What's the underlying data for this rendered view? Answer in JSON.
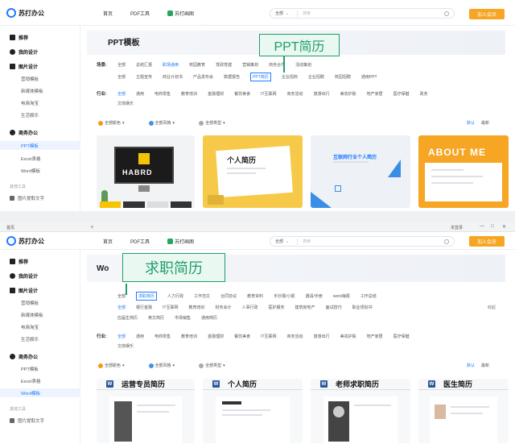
{
  "top": {
    "logo_text": "苏打办公",
    "nav": [
      "首页",
      "PDF工具",
      "苏打画图"
    ],
    "search": {
      "select": "全部",
      "placeholder": "搜索"
    },
    "join_button": "加入会员",
    "sidebar": {
      "heads": [
        "推荐",
        "我的设计",
        "图片设计",
        "商务办公"
      ],
      "image_design": [
        "营销模板",
        "新媒体模板",
        "电商淘宝",
        "生活娱乐"
      ],
      "office": [
        "PPT模板",
        "Excel表格",
        "Word模板"
      ],
      "other_label": "其他工具",
      "other_item": "图片提取文字"
    },
    "page_title": "PPT模板",
    "row1_label": "场景:",
    "row1": [
      "全部",
      "总结汇报",
      "职场通用",
      "校园教育",
      "党政党建",
      "营销策划",
      "商务合作",
      "活动策划"
    ],
    "row2": [
      "全部",
      "主题宣传",
      "商业计划书",
      "产品发布会",
      "数据报告",
      "PPT简历",
      "企业招商",
      "企业招聘",
      "校园招聘",
      "通用PPT"
    ],
    "row3_label": "行业:",
    "row3": [
      "全部",
      "通用",
      "电商零售",
      "教育培训",
      "金融理财",
      "餐饮美食",
      "IT互联网",
      "商务活动",
      "旅游出行",
      "美妆护肤",
      "地产家居",
      "医疗保健",
      "政务"
    ],
    "row4": [
      "文体娱乐"
    ],
    "filters": [
      "全部颜色",
      "全部风格",
      "全部类型"
    ],
    "sort": [
      "默认",
      "最新"
    ],
    "callout": "PPT简历",
    "cards": [
      {
        "label": "HABRD",
        "color": "#f2f3f5"
      },
      {
        "label": "个人简历",
        "color": "#f7c948"
      },
      {
        "label": "互联网行业个人简历",
        "color": "#eef1f5"
      },
      {
        "label": "ABOUT ME",
        "color": "#f6a623"
      }
    ]
  },
  "bottom": {
    "tab": "首页",
    "user": "未登录",
    "logo_text": "苏打办公",
    "nav": [
      "首页",
      "PDF工具",
      "苏打画图"
    ],
    "search": {
      "select": "全部",
      "placeholder": "搜索"
    },
    "join_button": "加入会员",
    "page_title_prefix": "Wo",
    "callout": "求职简历",
    "row1": [
      "全部",
      "求职简历",
      "人力行政",
      "工作范文",
      "合同协议",
      "教育资料",
      "手抄报/小报",
      "邀请/手册",
      "word海报",
      "工作总结"
    ],
    "row2": [
      "全部",
      "银行金融",
      "IT互联网",
      "教育培训",
      "财务会计",
      "人事行政",
      "医护服务",
      "建筑房地产",
      "面试技巧",
      "职业规划书"
    ],
    "row2_more": "收起",
    "row3": [
      "应届生简历",
      "英文简历",
      "市场销售",
      "通用简历"
    ],
    "row4_label": "行业:",
    "row4": [
      "全部",
      "通用",
      "电商零售",
      "教育培训",
      "金融理财",
      "餐饮美食",
      "IT互联网",
      "商务活动",
      "旅游出行",
      "美妆护肤",
      "地产家居",
      "医疗保健"
    ],
    "row5": [
      "文体娱乐"
    ],
    "filters": [
      "全部颜色",
      "全部风格",
      "全部类型"
    ],
    "sort": [
      "默认",
      "最新"
    ],
    "cards": [
      "运营专员简历",
      "个人简历",
      "老师求职简历",
      "医生简历"
    ]
  }
}
